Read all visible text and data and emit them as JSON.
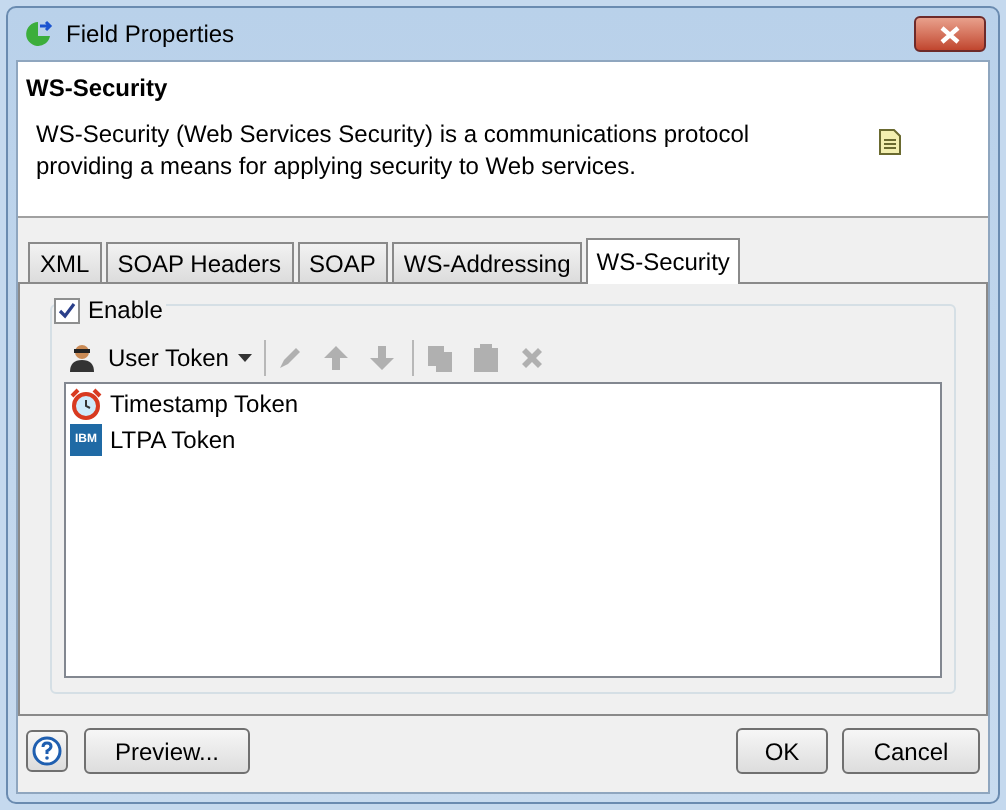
{
  "window": {
    "title": "Field Properties"
  },
  "header": {
    "title": "WS-Security",
    "description": "WS-Security (Web Services Security) is a communications protocol providing a means for applying security to Web services."
  },
  "tabs": [
    {
      "label": "XML",
      "selected": false
    },
    {
      "label": "SOAP Headers",
      "selected": false
    },
    {
      "label": "SOAP",
      "selected": false
    },
    {
      "label": "WS-Addressing",
      "selected": false
    },
    {
      "label": "WS-Security",
      "selected": true
    }
  ],
  "enable": {
    "label": "Enable",
    "checked": true
  },
  "toolbar": {
    "add_button": {
      "label": "User Token",
      "disabled": false
    },
    "tools": [
      {
        "kind": "pencil",
        "disabled": true
      },
      {
        "kind": "up",
        "disabled": true
      },
      {
        "kind": "down",
        "disabled": true
      },
      {
        "kind": "copy",
        "disabled": true
      },
      {
        "kind": "paste",
        "disabled": true
      },
      {
        "kind": "delete",
        "disabled": true
      }
    ]
  },
  "tokens": [
    {
      "label": "Timestamp Token",
      "kind": "clock",
      "selected": false
    },
    {
      "label": "LTPA Token",
      "kind": "badge",
      "badge": "IBM",
      "selected": false
    }
  ],
  "buttons": [
    {
      "label": "Preview...",
      "kind": "preview"
    },
    {
      "label": "OK",
      "kind": "default"
    },
    {
      "label": "Cancel",
      "kind": "normal"
    }
  ]
}
